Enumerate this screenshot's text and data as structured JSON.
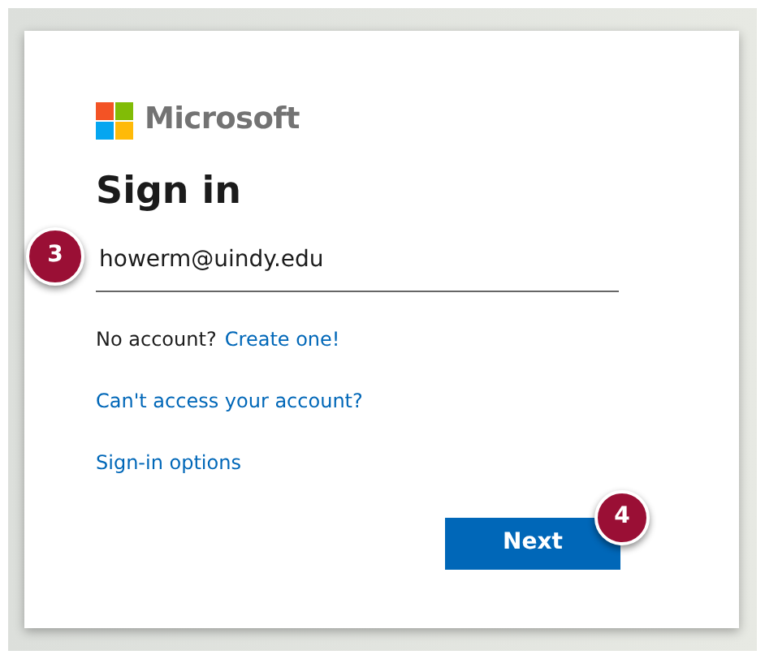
{
  "logo": {
    "text": "Microsoft"
  },
  "heading": "Sign in",
  "email_field": {
    "value": "howerm@uindy.edu",
    "callout": "3"
  },
  "links": [
    {
      "kind": "prompt",
      "prefix": "No account?",
      "text": "Create one!"
    },
    {
      "kind": "link",
      "text": "Can't access your account?"
    },
    {
      "kind": "link",
      "text": "Sign-in options"
    }
  ],
  "next_button": {
    "label": "Next",
    "callout": "4"
  }
}
